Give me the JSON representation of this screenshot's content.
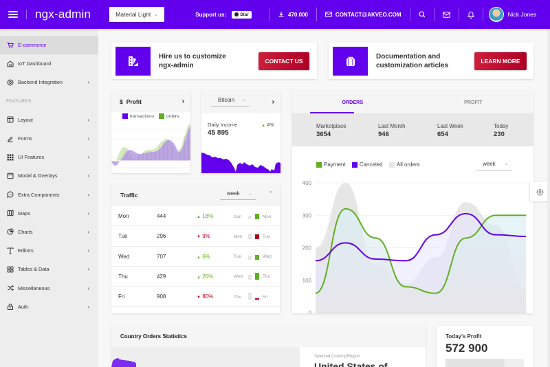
{
  "header": {
    "logo": "ngx-admin",
    "theme_select": "Material Light",
    "support_label": "Support us:",
    "star_label": "Star",
    "downloads": "470.000",
    "contact_email": "CONTACT@AKVEO.COM",
    "user_name": "Nick Jones",
    "brand_color": "#6200ee"
  },
  "sidebar": {
    "items": [
      {
        "label": "E-commerce",
        "icon": "shopping-cart-icon",
        "active": true
      },
      {
        "label": "IoT Dashboard",
        "icon": "home-icon"
      },
      {
        "label": "Backend Integration",
        "icon": "settings-icon",
        "expandable": true
      }
    ],
    "section_label": "FEATURES",
    "features": [
      {
        "label": "Layout",
        "icon": "layout-icon"
      },
      {
        "label": "Forms",
        "icon": "edit-icon"
      },
      {
        "label": "UI Features",
        "icon": "keypad-icon"
      },
      {
        "label": "Modal & Overlays",
        "icon": "browser-icon"
      },
      {
        "label": "Extra Components",
        "icon": "message-circle-icon"
      },
      {
        "label": "Maps",
        "icon": "map-icon"
      },
      {
        "label": "Charts",
        "icon": "pie-chart-icon"
      },
      {
        "label": "Editors",
        "icon": "text-icon"
      },
      {
        "label": "Tables & Data",
        "icon": "grid-icon"
      },
      {
        "label": "Miscellaneous",
        "icon": "shuffle-icon"
      },
      {
        "label": "Auth",
        "icon": "lock-icon"
      }
    ]
  },
  "promo": {
    "hire_text": "Hire us to customize ngx-admin",
    "hire_button": "CONTACT US",
    "docs_text": "Documentation and customization articles",
    "docs_button": "LEARN MORE"
  },
  "profit_card": {
    "title": "Profit",
    "currency_symbol": "$",
    "legend": [
      {
        "label": "transactions",
        "color": "#6200ee"
      },
      {
        "label": "orders",
        "color": "#60af20"
      }
    ]
  },
  "bitcoin_card": {
    "currency_select": "Bitcoin",
    "label": "Daily Income",
    "value": "45 895",
    "delta": "4%",
    "delta_direction": "up"
  },
  "traffic": {
    "title": "Traffic",
    "period": "week",
    "rows": [
      {
        "day": "Mon",
        "value": "444",
        "delta": "18%",
        "dir": "up",
        "prev": "Sun",
        "next": "Mon",
        "prev_level": 0.4,
        "curr_level": 0.65
      },
      {
        "day": "Tue",
        "value": "296",
        "delta": "9%",
        "dir": "down",
        "prev": "Mon",
        "next": "Tue",
        "prev_level": 0.65,
        "curr_level": 0.6
      },
      {
        "day": "Wed",
        "value": "707",
        "delta": "6%",
        "dir": "up",
        "prev": "Tue",
        "next": "Wed",
        "prev_level": 0.5,
        "curr_level": 0.55
      },
      {
        "day": "Thu",
        "value": "429",
        "delta": "26%",
        "dir": "up",
        "prev": "Wed",
        "next": "Thu",
        "prev_level": 0.55,
        "curr_level": 0.85
      },
      {
        "day": "Fri",
        "value": "908",
        "delta": "80%",
        "dir": "down",
        "prev": "Thu",
        "next": "Fri",
        "prev_level": 0.85,
        "curr_level": 0.1
      }
    ],
    "up_color": "#60af20",
    "down_color": "#b00020"
  },
  "orders": {
    "tabs": [
      {
        "label": "ORDERS",
        "active": true
      },
      {
        "label": "PROFIT"
      }
    ],
    "stats": [
      {
        "label": "Marketplace",
        "value": "3654"
      },
      {
        "label": "Last Month",
        "value": "946"
      },
      {
        "label": "Last Week",
        "value": "654"
      },
      {
        "label": "Today",
        "value": "230"
      }
    ],
    "period": "week"
  },
  "chart_data": {
    "type": "line",
    "title": "",
    "xlabel": "",
    "ylabel": "",
    "ylim": [
      0,
      400
    ],
    "yticks": [
      0,
      100,
      200,
      300,
      400
    ],
    "grid": true,
    "legend": "top-left",
    "x": [
      0,
      1,
      2,
      3,
      4,
      5,
      6,
      7
    ],
    "series": [
      {
        "name": "Payment",
        "color": "#60af20",
        "values": [
          60,
          320,
          230,
          80,
          60,
          230,
          300,
          300
        ]
      },
      {
        "name": "Canceled",
        "color": "#6200ee",
        "values": [
          160,
          215,
          165,
          160,
          240,
          305,
          240,
          235
        ]
      },
      {
        "name": "All orders",
        "color": "#e6e6e6",
        "values": [
          200,
          400,
          150,
          90,
          170,
          340,
          270,
          70
        ]
      }
    ]
  },
  "country_stats": {
    "title": "Country Orders Statistics",
    "selected_label": "Selected Country/Region",
    "selected_value": "United States of"
  },
  "todays_profit": {
    "title": "Today's Profit",
    "value": "572 900"
  }
}
